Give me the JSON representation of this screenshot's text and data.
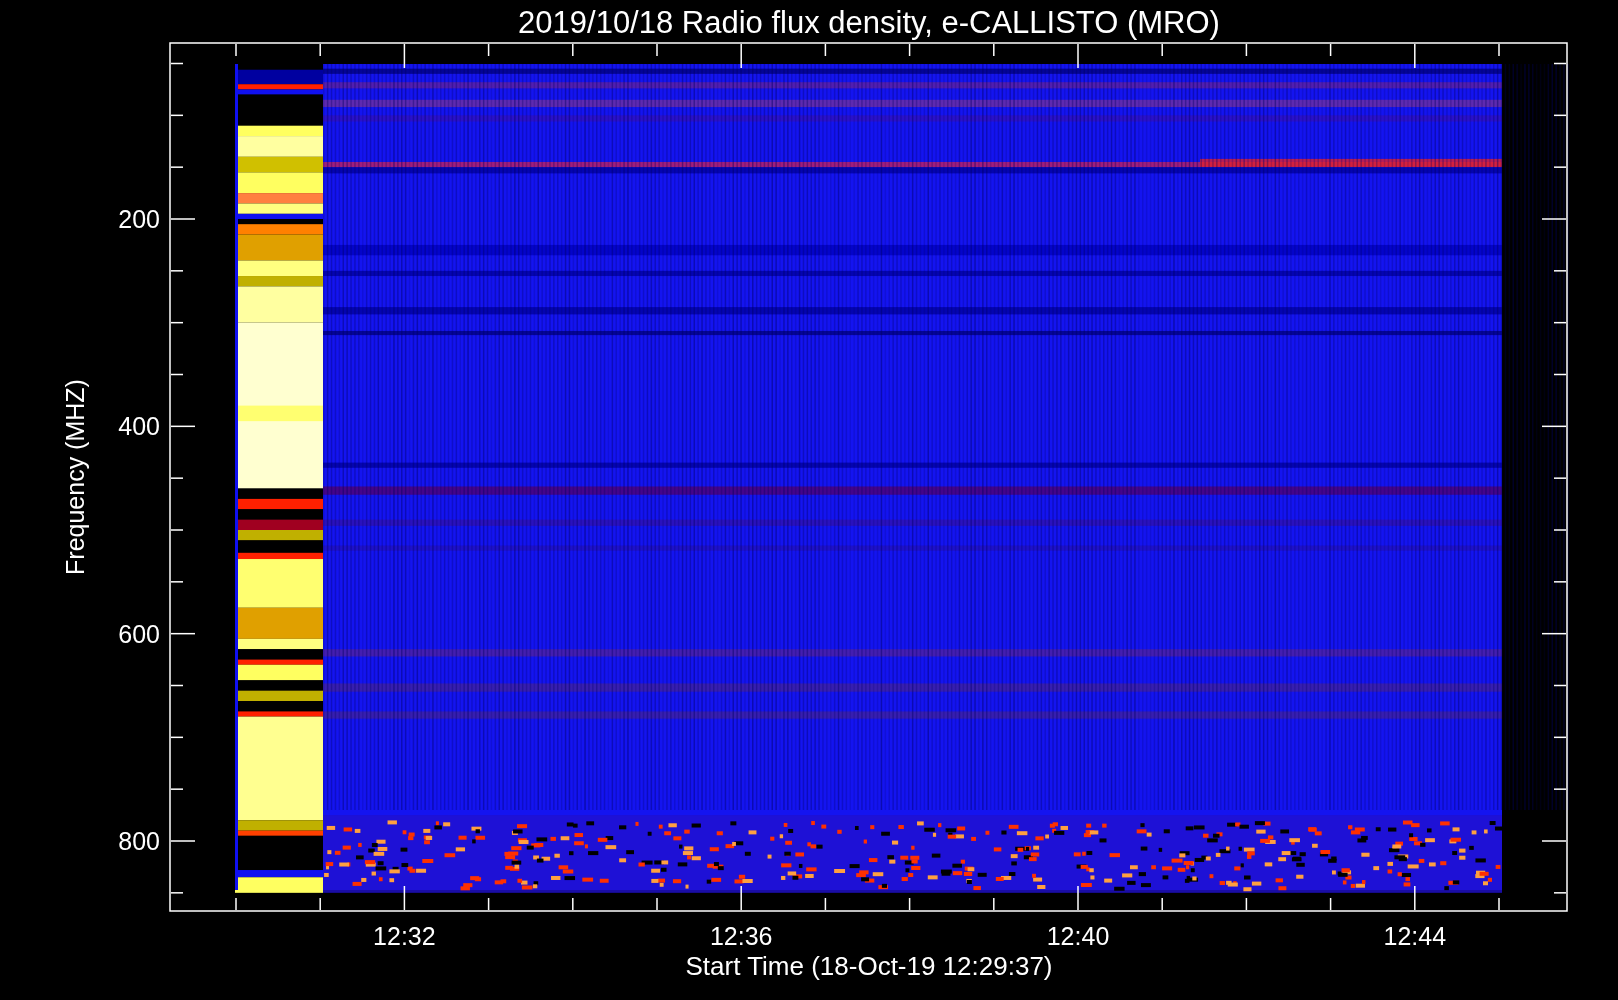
{
  "title": "2019/10/18  Radio flux density, e-CALLISTO (MRO)",
  "y_axis": {
    "label": "Frequency (MHZ)",
    "ticks": [
      "200",
      "400",
      "600",
      "800"
    ]
  },
  "x_axis": {
    "label": "Start Time (18-Oct-19 12:29:37)",
    "ticks": [
      "12:32",
      "12:36",
      "12:40",
      "12:44"
    ]
  }
}
